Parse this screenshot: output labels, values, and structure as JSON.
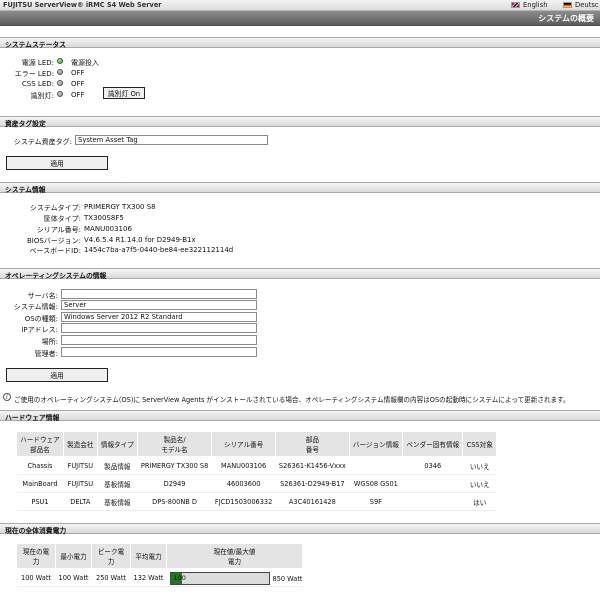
{
  "header": {
    "brand": "FUJITSU ServerView® iRMC S4 Web Server",
    "lang_en": "English",
    "lang_de": "Deutsc",
    "page_title": "システムの概要"
  },
  "status": {
    "heading": "システムステータス",
    "items": [
      {
        "label": "電源 LED:",
        "value": "電源投入",
        "led": "green"
      },
      {
        "label": "エラー LED:",
        "value": "OFF",
        "led": "gray"
      },
      {
        "label": "CSS LED:",
        "value": "OFF",
        "led": "gray"
      },
      {
        "label": "識別灯:",
        "value": "OFF",
        "led": "gray"
      }
    ],
    "identify_button": "識別灯 On"
  },
  "asset": {
    "heading": "資産タグ設定",
    "label": "システム資産タグ:",
    "value": "System Asset Tag",
    "apply": "適用"
  },
  "sysinfo": {
    "heading": "システム情報",
    "rows": [
      {
        "label": "システムタイプ:",
        "value": "PRIMERGY TX300 S8"
      },
      {
        "label": "筐体タイプ:",
        "value": "TX300S8F5"
      },
      {
        "label": "シリアル番号:",
        "value": "MANU003106"
      },
      {
        "label": "BIOSバージョン:",
        "value": "V4.6.5.4 R1.14.0 for D2949-B1x"
      },
      {
        "label": "ベースボードID:",
        "value": "1454c7ba-a7f5-0440-be84-ee322112114d"
      }
    ]
  },
  "os": {
    "heading": "オペレーティングシステムの情報",
    "fields": [
      {
        "label": "サーバ名:",
        "value": ""
      },
      {
        "label": "システム情報:",
        "value": "Server"
      },
      {
        "label": "OSの種類:",
        "value": "Windows Server 2012 R2 Standard"
      },
      {
        "label": "IPアドレス:",
        "value": ""
      },
      {
        "label": "場所:",
        "value": ""
      },
      {
        "label": "管理者:",
        "value": ""
      }
    ],
    "apply": "適用",
    "note": "ご使用のオペレーティングシステム(OS)に ServerView Agents がインストールされている場合、オペレーティングシステム情報欄の内容はOSの起動時にシステムによって更新されます。"
  },
  "hardware": {
    "heading": "ハードウェア情報",
    "columns": [
      "ハードウェア\n部品名",
      "製造会社",
      "情報タイプ",
      "製品名/\nモデル名",
      "シリアル番号",
      "部品\n番号",
      "バージョン情報",
      "ベンダー固有情報",
      "CSS対象"
    ],
    "rows": [
      [
        "Chassis",
        "FUJITSU",
        "製品情報",
        "PRIMERGY TX300 S8",
        "MANU003106",
        "S26361-K1456-Vxxx",
        "",
        "0346",
        "いいえ"
      ],
      [
        "MainBoard",
        "FUJITSU",
        "基板情報",
        "D2949",
        "46003600",
        "S26361-D2949-B17",
        "WGS08 GS01",
        "",
        "いいえ"
      ],
      [
        "PSU1",
        "DELTA",
        "基板情報",
        "DPS-800NB D",
        "FJCD1503006332",
        "A3C40161428",
        "S9F",
        "",
        "はい"
      ]
    ]
  },
  "power": {
    "heading": "現在の全体消費電力",
    "columns": [
      "現在の電力",
      "最小電力",
      "ピーク電力",
      "平均電力",
      "現在値/最大値\n電力"
    ],
    "values": [
      "100 Watt",
      "100 Watt",
      "250 Watt",
      "132 Watt"
    ],
    "bar_label": "100",
    "bar_fraction": 0.1176,
    "max_label": "850 Watt"
  }
}
